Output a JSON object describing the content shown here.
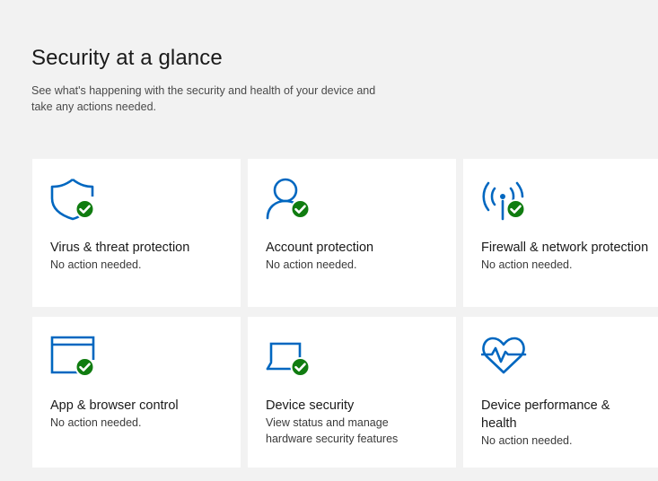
{
  "header": {
    "title": "Security at a glance",
    "subtitle": "See what's happening with the security and health of your device and take any actions needed."
  },
  "colors": {
    "accent": "#0067c0",
    "ok_badge": "#107c10",
    "background": "#f2f2f2",
    "tile": "#ffffff"
  },
  "tiles": [
    {
      "icon": "shield-icon",
      "title": "Virus & threat protection",
      "status": "No action needed.",
      "badge": "ok"
    },
    {
      "icon": "person-icon",
      "title": "Account protection",
      "status": "No action needed.",
      "badge": "ok"
    },
    {
      "icon": "wifi-antenna-icon",
      "title": "Firewall & network protection",
      "status": "No action needed.",
      "badge": "ok"
    },
    {
      "icon": "browser-window-icon",
      "title": "App & browser control",
      "status": "No action needed.",
      "badge": "ok"
    },
    {
      "icon": "laptop-icon",
      "title": "Device security",
      "status": "View status and manage hardware security features",
      "badge": "ok"
    },
    {
      "icon": "heart-pulse-icon",
      "title": "Device performance & health",
      "status": "No action needed.",
      "badge": "none"
    }
  ]
}
